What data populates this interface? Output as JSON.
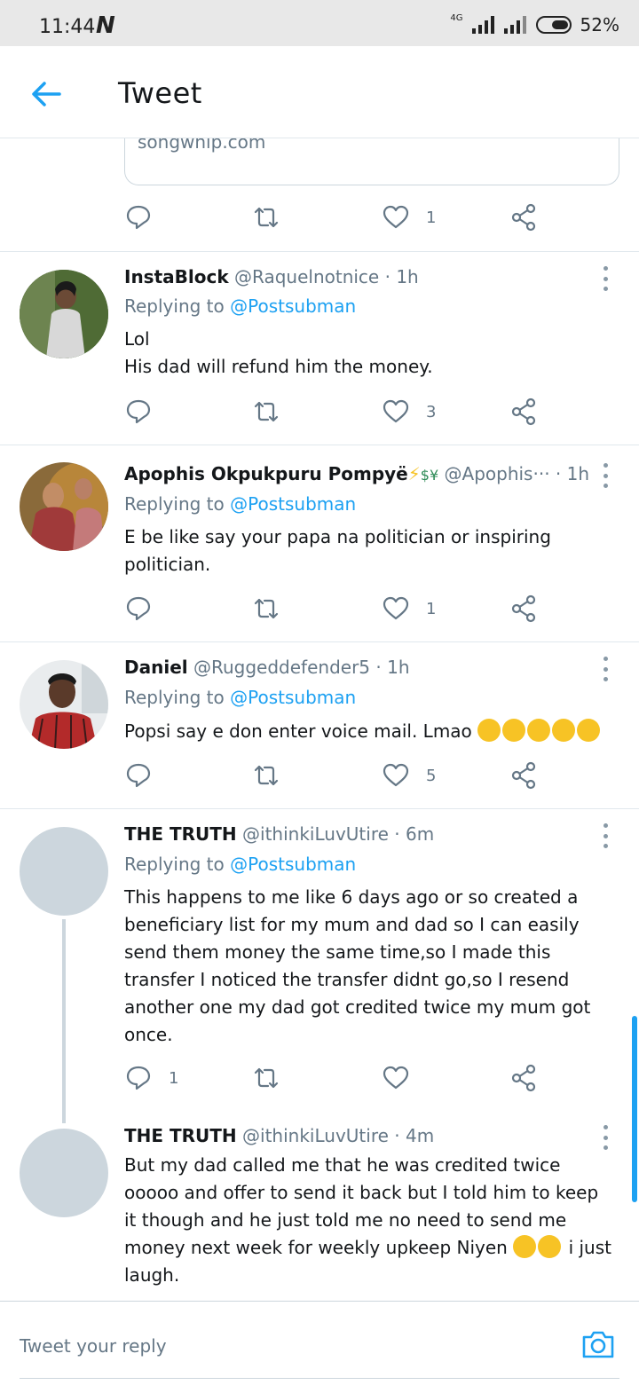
{
  "status_bar": {
    "time": "11:44",
    "network_glyph": "N",
    "network_type": "4G",
    "battery": "52%"
  },
  "app_bar": {
    "title": "Tweet"
  },
  "colors": {
    "accent": "#1da1f2",
    "secondary_text": "#657786",
    "divider": "#e1e8ed"
  },
  "link_card": {
    "domain": "songwhip.com"
  },
  "top_actions": {
    "reply": "",
    "retweet": "",
    "like": "1"
  },
  "tweets": [
    {
      "name": "InstaBlock",
      "handle": "@Raquelnotnice",
      "time": "1h",
      "replying_prefix": "Replying to",
      "replying_to": "@Postsubman",
      "body": [
        "Lol",
        "His dad will refund him the money."
      ],
      "reply_count": "",
      "like_count": "3"
    },
    {
      "name": "Apophis Okpukpuru Pompyë",
      "handle": "@Apophis···",
      "time": "1h",
      "replying_prefix": "Replying to",
      "replying_to": "@Postsubman",
      "body": [
        "E be like say your papa na politician or inspiring",
        "politician."
      ],
      "reply_count": "",
      "like_count": "1"
    },
    {
      "name": "Daniel",
      "handle": "@Ruggeddefender5",
      "time": "1h",
      "replying_prefix": "Replying to",
      "replying_to": "@Postsubman",
      "body": [
        "Popsi say e don enter voice mail. Lmao"
      ],
      "reply_count": "",
      "like_count": "5"
    },
    {
      "name": "THE TRUTH",
      "handle": "@ithinkiLuvUtire",
      "time": "6m",
      "replying_prefix": "Replying to",
      "replying_to": "@Postsubman",
      "body": [
        "This happens to me like 6 days ago or so created a",
        "beneficiary list for my mum and dad so I can easily",
        "send them money the same time,so I made this",
        "transfer I noticed the transfer didnt go,so I resend",
        "another one my dad got credited twice my mum got",
        "once."
      ],
      "reply_count": "1",
      "like_count": ""
    },
    {
      "name": "THE TRUTH",
      "handle": "@ithinkiLuvUtire",
      "time": "4m",
      "body": [
        "But my dad called me that he was credited twice",
        "ooooo and offer to send it back but I told him to keep",
        "it though and he just told me no need to send me",
        "money next week for weekly upkeep Niyen",
        "i just",
        "laugh."
      ]
    }
  ],
  "composer": {
    "placeholder": "Tweet your reply"
  }
}
